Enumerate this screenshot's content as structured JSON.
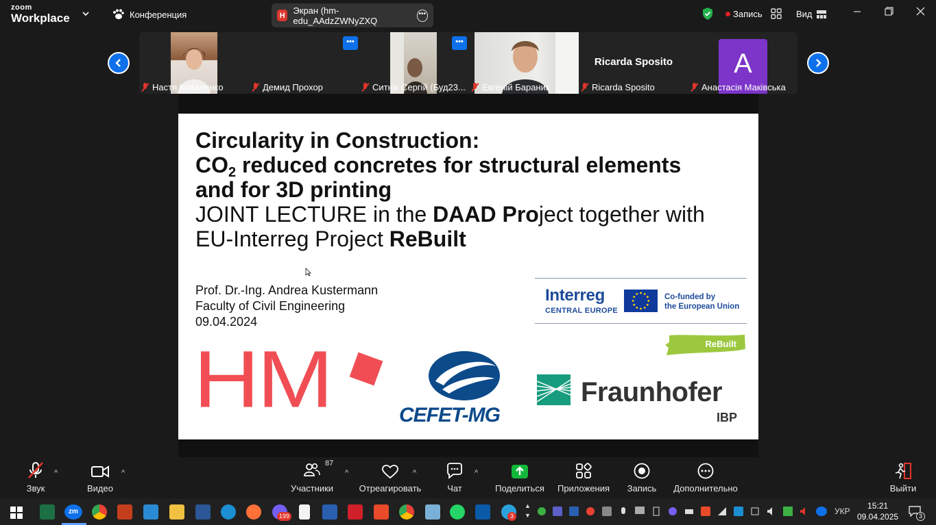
{
  "topbar": {
    "logo_line1": "zoom",
    "logo_line2": "Workplace",
    "conference_label": "Конференция",
    "screen_tab_badge": "H",
    "screen_tab_title": "Экран (hm-edu_AAdzZWNyZXQ",
    "record_label": "Запись",
    "view_label": "Вид"
  },
  "participants": [
    {
      "name": "Настя Коваленко",
      "muted": true,
      "video": true
    },
    {
      "name": "Демид Прохор",
      "muted": true,
      "video": false
    },
    {
      "name": "Ситнік Сергій (Буд23...",
      "muted": true,
      "video": true
    },
    {
      "name": "Евгеній Бараник",
      "muted": true,
      "video": true
    },
    {
      "name": "Ricarda Sposito",
      "display": "Ricarda Sposito",
      "muted": true,
      "video": false
    },
    {
      "name": "Анастасія Маківська",
      "avatar_letter": "A",
      "muted": true,
      "video": false
    }
  ],
  "slide": {
    "title_line1": "Circularity in Construction:",
    "title_line2_a": "CO",
    "title_line2_sub": "2",
    "title_line2_b": " reduced concretes for structural elements",
    "title_line3": "and for 3D printing",
    "line4_a": "JOINT LECTURE in the ",
    "line4_b": "DAAD Pro",
    "line4_c": "ject together with",
    "line5_a": "EU-Interreg Project ",
    "line5_b": "ReBuilt",
    "author": "Prof. Dr.-Ing. Andrea Kustermann",
    "faculty": "Faculty of Civil Engineering",
    "date": "09.04.2024",
    "logo_hm": "HM",
    "logo_cefet": "CEFET-MG",
    "interreg_name": "Interreg",
    "interreg_region": "CENTRAL EUROPE",
    "eu_line1": "Co-funded by",
    "eu_line2": "the European Union",
    "rebuilt_label": "ReBuilt",
    "fraunhofer_name": "Fraunhofer",
    "fraunhofer_unit": "IBP"
  },
  "toolbar": {
    "audio": "Звук",
    "video": "Видео",
    "participants": "Участники",
    "participants_count": "87",
    "react": "Отреагировать",
    "chat": "Чат",
    "share": "Поделиться",
    "apps": "Приложения",
    "record": "Запись",
    "more": "Дополнительно",
    "leave": "Выйти"
  },
  "taskbar": {
    "viber_badge": "199",
    "telegram_badge": "3",
    "language": "УКР",
    "time": "15:21",
    "date": "09.04.2025",
    "notifications": "3"
  },
  "colors": {
    "zoom_blue": "#0e71eb",
    "share_green": "#12b83a",
    "hm_red": "#f04e54",
    "cefet_blue": "#0c4a8a",
    "fraunhofer_green": "#179c7d",
    "rebuilt_green": "#9cc83f"
  }
}
